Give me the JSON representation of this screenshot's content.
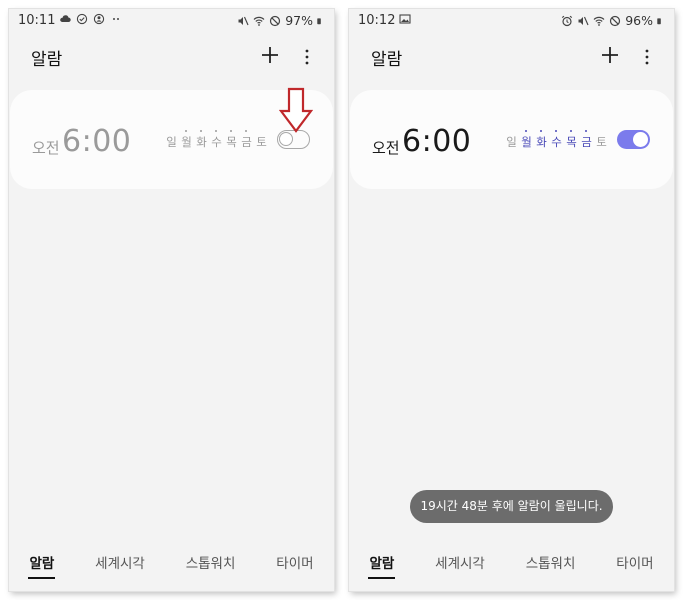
{
  "colors": {
    "accent": "#7b7bec",
    "panel_bg": "#f3f3f3",
    "arrow": "#c0282b"
  },
  "panels": [
    {
      "status": {
        "time": "10:11",
        "battery": "97%",
        "left_icons": [
          "cloud-icon",
          "check-circle-icon",
          "person-circle-icon",
          "more-dots-icon"
        ],
        "right_icons": [
          "mute-icon",
          "wifi-icon",
          "dnd-icon",
          "battery-icon"
        ]
      },
      "title": "알람",
      "alarm": {
        "ampm": "오전",
        "time": "6:00",
        "days": [
          "일",
          "월",
          "화",
          "수",
          "목",
          "금",
          "토"
        ],
        "enabled": false
      },
      "tabs": [
        "알람",
        "세계시각",
        "스톱워치",
        "타이머"
      ],
      "active_tab": 0,
      "annotation": "down-arrow-pointing-to-toggle"
    },
    {
      "status": {
        "time": "10:12",
        "battery": "96%",
        "left_icons": [
          "image-icon"
        ],
        "right_icons": [
          "alarm-clock-icon",
          "mute-icon",
          "wifi-icon",
          "dnd-icon",
          "battery-icon"
        ]
      },
      "title": "알람",
      "alarm": {
        "ampm": "오전",
        "time": "6:00",
        "days": [
          "일",
          "월",
          "화",
          "수",
          "목",
          "금",
          "토"
        ],
        "enabled": true
      },
      "tabs": [
        "알람",
        "세계시각",
        "스톱워치",
        "타이머"
      ],
      "active_tab": 0,
      "toast": "19시간 48분 후에 알람이 울립니다."
    }
  ]
}
